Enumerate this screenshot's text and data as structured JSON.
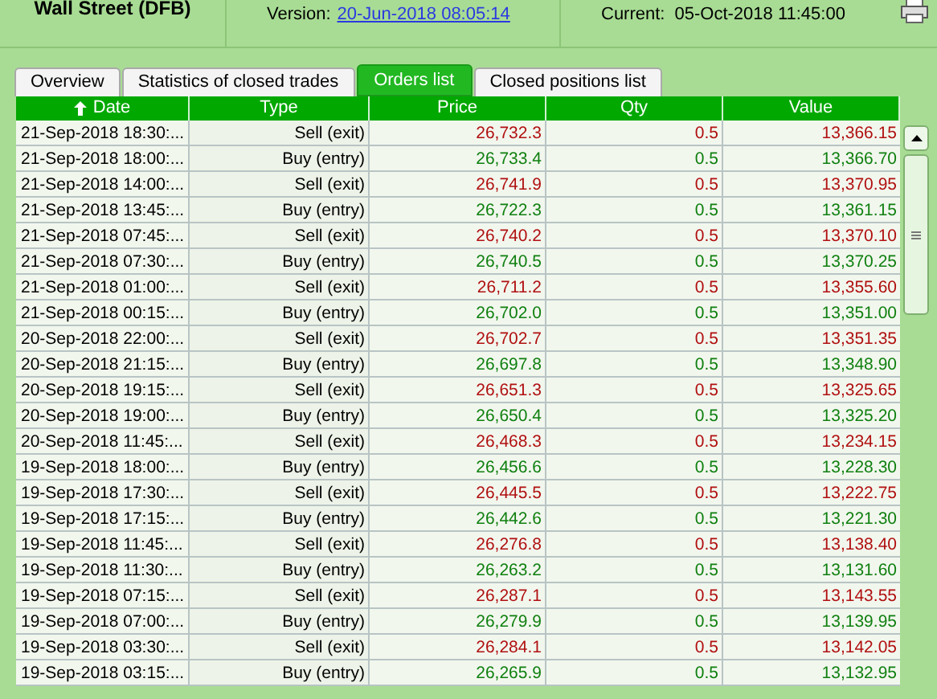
{
  "header": {
    "instrument": "Wall Street (DFB)",
    "version_label": "Version:",
    "version_link": "20-Jun-2018 08:05:14",
    "current_label": "Current:",
    "current_value": "05-Oct-2018 11:45:00"
  },
  "tabs": [
    {
      "label": "Overview",
      "selected": false
    },
    {
      "label": "Statistics of closed trades",
      "selected": false
    },
    {
      "label": "Orders list",
      "selected": true
    },
    {
      "label": "Closed positions list",
      "selected": false
    }
  ],
  "table": {
    "columns": [
      "Date",
      "Type",
      "Price",
      "Qty",
      "Value"
    ],
    "rows": [
      {
        "kind": "sell",
        "date": "21-Sep-2018 18:30:...",
        "type": "Sell (exit)",
        "price": "26,732.3",
        "qty": "0.5",
        "value": "13,366.15"
      },
      {
        "kind": "buy",
        "date": "21-Sep-2018 18:00:...",
        "type": "Buy (entry)",
        "price": "26,733.4",
        "qty": "0.5",
        "value": "13,366.70"
      },
      {
        "kind": "sell",
        "date": "21-Sep-2018 14:00:...",
        "type": "Sell (exit)",
        "price": "26,741.9",
        "qty": "0.5",
        "value": "13,370.95"
      },
      {
        "kind": "buy",
        "date": "21-Sep-2018 13:45:...",
        "type": "Buy (entry)",
        "price": "26,722.3",
        "qty": "0.5",
        "value": "13,361.15"
      },
      {
        "kind": "sell",
        "date": "21-Sep-2018 07:45:...",
        "type": "Sell (exit)",
        "price": "26,740.2",
        "qty": "0.5",
        "value": "13,370.10"
      },
      {
        "kind": "buy",
        "date": "21-Sep-2018 07:30:...",
        "type": "Buy (entry)",
        "price": "26,740.5",
        "qty": "0.5",
        "value": "13,370.25"
      },
      {
        "kind": "sell",
        "date": "21-Sep-2018 01:00:...",
        "type": "Sell (exit)",
        "price": "26,711.2",
        "qty": "0.5",
        "value": "13,355.60"
      },
      {
        "kind": "buy",
        "date": "21-Sep-2018 00:15:...",
        "type": "Buy (entry)",
        "price": "26,702.0",
        "qty": "0.5",
        "value": "13,351.00"
      },
      {
        "kind": "sell",
        "date": "20-Sep-2018 22:00:...",
        "type": "Sell (exit)",
        "price": "26,702.7",
        "qty": "0.5",
        "value": "13,351.35"
      },
      {
        "kind": "buy",
        "date": "20-Sep-2018 21:15:...",
        "type": "Buy (entry)",
        "price": "26,697.8",
        "qty": "0.5",
        "value": "13,348.90"
      },
      {
        "kind": "sell",
        "date": "20-Sep-2018 19:15:...",
        "type": "Sell (exit)",
        "price": "26,651.3",
        "qty": "0.5",
        "value": "13,325.65"
      },
      {
        "kind": "buy",
        "date": "20-Sep-2018 19:00:...",
        "type": "Buy (entry)",
        "price": "26,650.4",
        "qty": "0.5",
        "value": "13,325.20"
      },
      {
        "kind": "sell",
        "date": "20-Sep-2018 11:45:...",
        "type": "Sell (exit)",
        "price": "26,468.3",
        "qty": "0.5",
        "value": "13,234.15"
      },
      {
        "kind": "buy",
        "date": "19-Sep-2018 18:00:...",
        "type": "Buy (entry)",
        "price": "26,456.6",
        "qty": "0.5",
        "value": "13,228.30"
      },
      {
        "kind": "sell",
        "date": "19-Sep-2018 17:30:...",
        "type": "Sell (exit)",
        "price": "26,445.5",
        "qty": "0.5",
        "value": "13,222.75"
      },
      {
        "kind": "buy",
        "date": "19-Sep-2018 17:15:...",
        "type": "Buy (entry)",
        "price": "26,442.6",
        "qty": "0.5",
        "value": "13,221.30"
      },
      {
        "kind": "sell",
        "date": "19-Sep-2018 11:45:...",
        "type": "Sell (exit)",
        "price": "26,276.8",
        "qty": "0.5",
        "value": "13,138.40"
      },
      {
        "kind": "buy",
        "date": "19-Sep-2018 11:30:...",
        "type": "Buy (entry)",
        "price": "26,263.2",
        "qty": "0.5",
        "value": "13,131.60"
      },
      {
        "kind": "sell",
        "date": "19-Sep-2018 07:15:...",
        "type": "Sell (exit)",
        "price": "26,287.1",
        "qty": "0.5",
        "value": "13,143.55"
      },
      {
        "kind": "buy",
        "date": "19-Sep-2018 07:00:...",
        "type": "Buy (entry)",
        "price": "26,279.9",
        "qty": "0.5",
        "value": "13,139.95"
      },
      {
        "kind": "sell",
        "date": "19-Sep-2018 03:30:...",
        "type": "Sell (exit)",
        "price": "26,284.1",
        "qty": "0.5",
        "value": "13,142.05"
      },
      {
        "kind": "buy",
        "date": "19-Sep-2018 03:15:...",
        "type": "Buy (entry)",
        "price": "26,265.9",
        "qty": "0.5",
        "value": "13,132.95"
      }
    ]
  }
}
